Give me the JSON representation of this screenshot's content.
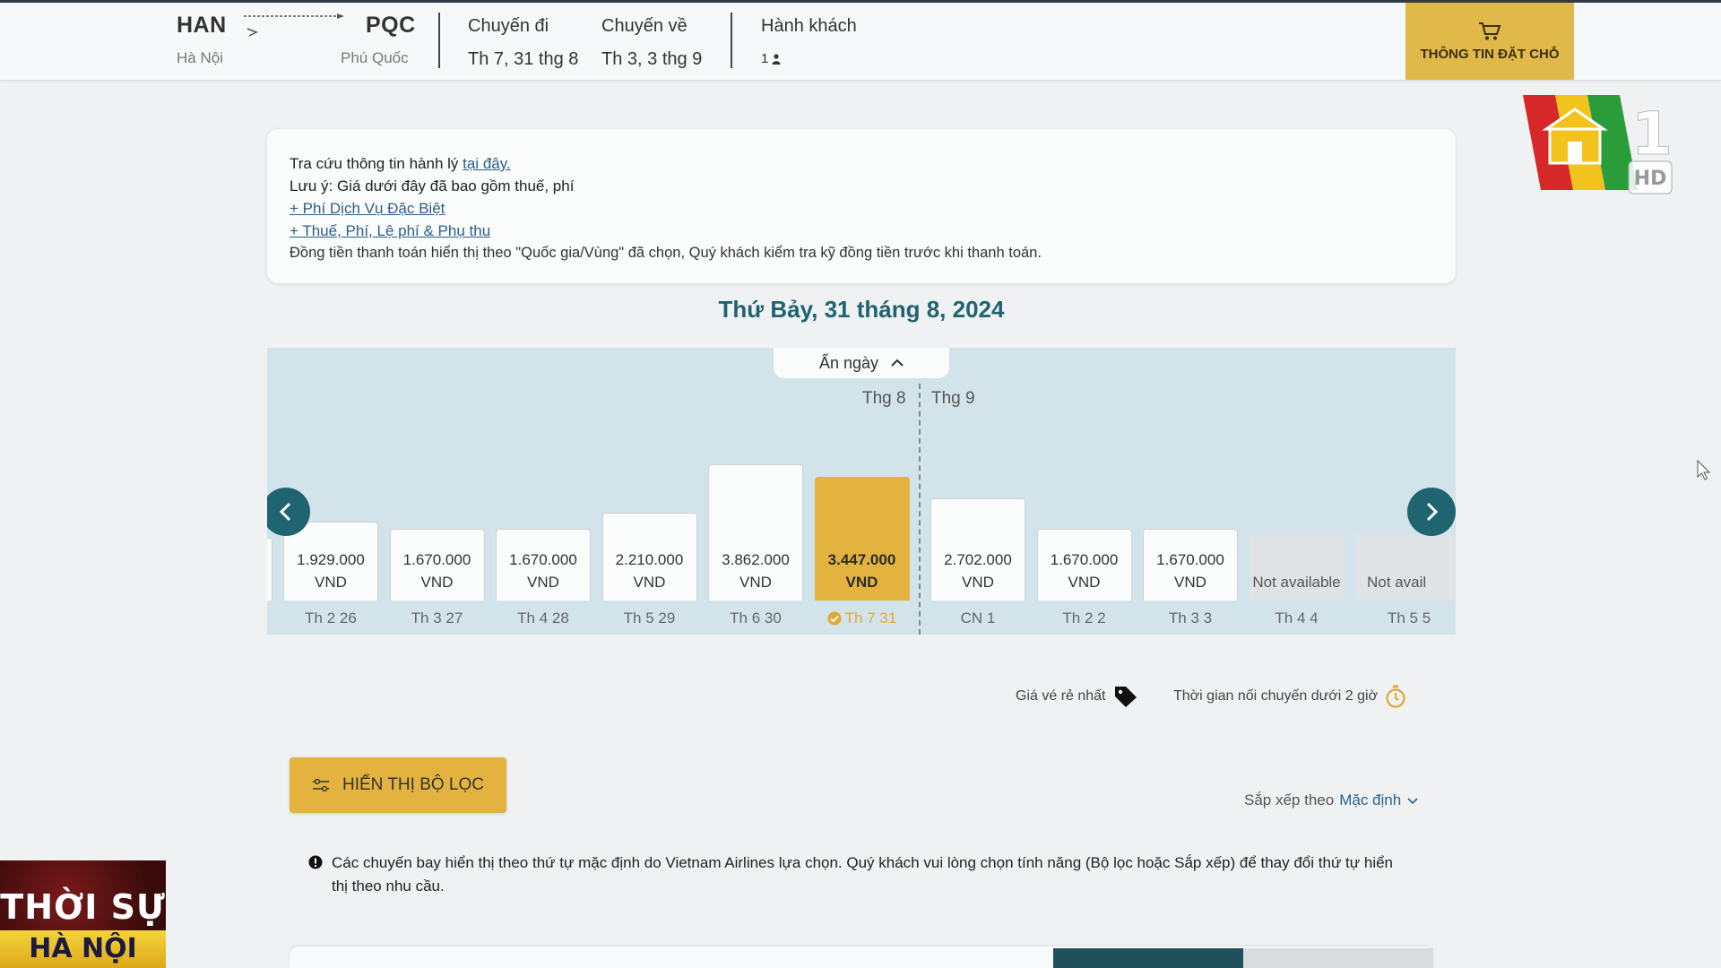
{
  "header": {
    "origin": {
      "code": "HAN",
      "city": "Hà Nội"
    },
    "destination": {
      "code": "PQC",
      "city": "Phú Quốc"
    },
    "outbound": {
      "label": "Chuyến đi",
      "date": "Th 7, 31 thg 8"
    },
    "return": {
      "label": "Chuyến về",
      "date": "Th 3, 3 thg 9"
    },
    "passengers": {
      "label": "Hành khách",
      "count": "1"
    },
    "booking_button": "THÔNG TIN ĐẶT CHỖ",
    "icons": {
      "cart": "cart-icon",
      "plane": "plane-icon",
      "person": "person-icon"
    }
  },
  "notice": {
    "baggage_prefix": "Tra cứu thông tin hành lý ",
    "baggage_link": "tại đây.",
    "price_note": "Lưu ý: Giá dưới đây đã bao gồm thuế, phí",
    "special_fee_link": "+ Phí Dịch Vụ Đặc Biệt",
    "tax_link": "+ Thuế, Phí, Lệ phí & Phụ thu",
    "currency_note": "Đồng tiền thanh toán hiển thị theo \"Quốc gia/Vùng\" đã chọn, Quý khách kiểm tra kỹ đồng tiền trước khi thanh toán."
  },
  "selected_date_title": "Thứ Bảy, 31 tháng 8, 2024",
  "calendar": {
    "hide_label": "Ẩn ngày",
    "month_aug": "Thg 8",
    "month_sep": "Thg 9",
    "days": [
      {
        "price": "1.929.000",
        "currency": "VND",
        "label": "Th 2 26",
        "value": 1929000,
        "status": "available"
      },
      {
        "price": "1.670.000",
        "currency": "VND",
        "label": "Th 3 27",
        "value": 1670000,
        "status": "available"
      },
      {
        "price": "1.670.000",
        "currency": "VND",
        "label": "Th 4 28",
        "value": 1670000,
        "status": "available"
      },
      {
        "price": "2.210.000",
        "currency": "VND",
        "label": "Th 5 29",
        "value": 2210000,
        "status": "available"
      },
      {
        "price": "3.862.000",
        "currency": "VND",
        "label": "Th 6 30",
        "value": 3862000,
        "status": "available"
      },
      {
        "price": "3.447.000",
        "currency": "VND",
        "label": "Th 7 31",
        "value": 3447000,
        "status": "selected"
      },
      {
        "price": "2.702.000",
        "currency": "VND",
        "label": "CN 1",
        "value": 2702000,
        "status": "available"
      },
      {
        "price": "1.670.000",
        "currency": "VND",
        "label": "Th 2 2",
        "value": 1670000,
        "status": "available"
      },
      {
        "price": "1.670.000",
        "currency": "VND",
        "label": "Th 3 3",
        "value": 1670000,
        "status": "available"
      },
      {
        "price": "Not available",
        "currency": "",
        "label": "Th 4 4",
        "value": null,
        "status": "na"
      },
      {
        "price": "Not avail",
        "currency": "",
        "label": "Th 5 5",
        "value": null,
        "status": "na"
      }
    ],
    "selected_color": "#e3b23f",
    "accent_color": "#1f6470"
  },
  "legend": {
    "cheapest": "Giá vé rẻ nhất",
    "short_connection": "Thời gian nối chuyến dưới 2 giờ"
  },
  "filter_button": "HIỂN THỊ BỘ LỌC",
  "sort": {
    "label": "Sắp xếp theo",
    "value": "Mặc định"
  },
  "info_text": "Các chuyến bay hiển thị theo thứ tự mặc định do Vietnam Airlines lựa chọn. Quý khách vui lòng chọn tính năng (Bộ lọc hoặc Sắp xếp) để thay đổi thứ tự hiển thị theo nhu cầu.",
  "overlay": {
    "channel_number": "1",
    "channel_hd": "HD",
    "news_line1": "THỜI SỰ",
    "news_line2": "HÀ NỘI"
  }
}
